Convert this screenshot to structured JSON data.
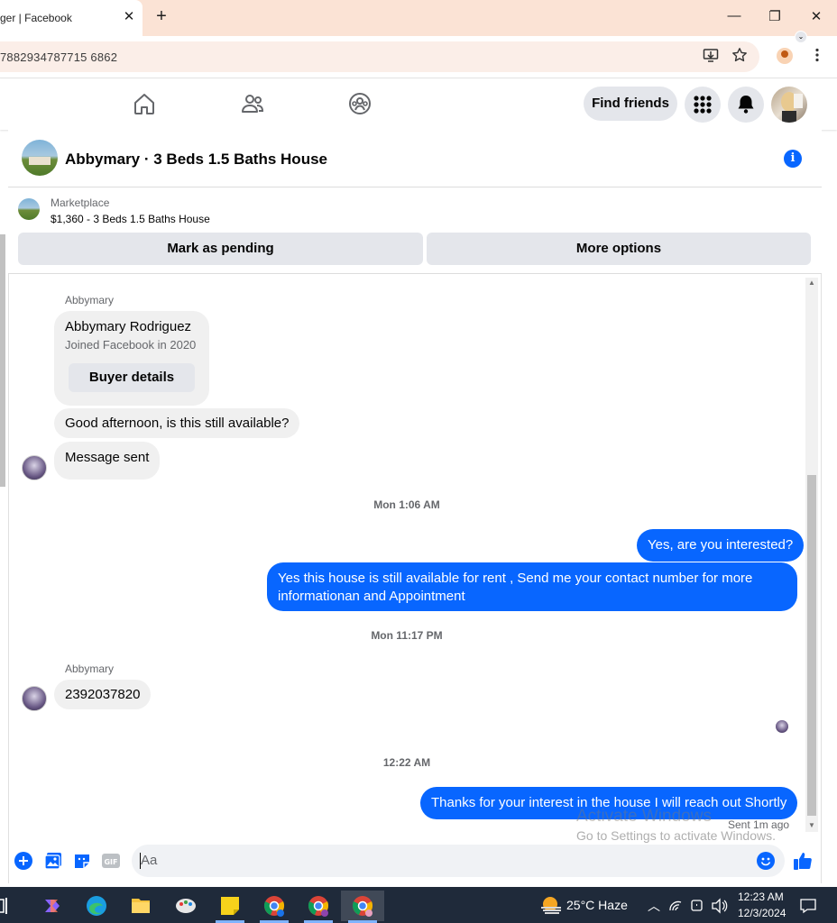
{
  "browser": {
    "tab_title": "ger | Facebook",
    "tab_close": "✕",
    "new_tab": "+",
    "url": "7882934787715 6862",
    "window_controls": [
      "—",
      "❐",
      "✕"
    ]
  },
  "fb_nav": {
    "find_friends": "Find friends"
  },
  "thread": {
    "title": "Abbymary · 3 Beds 1.5 Baths House",
    "info_icon": "i"
  },
  "marketplace": {
    "label": "Marketplace",
    "listing": "$1,360 - 3 Beds 1.5 Baths House",
    "mark_pending": "Mark as pending",
    "more_options": "More options"
  },
  "messages": {
    "sender_1": "Abbymary",
    "card_name": "Abbymary Rodriguez",
    "card_joined": "Joined Facebook in 2020",
    "card_button": "Buyer details",
    "msg_1": "Good afternoon, is this still available?",
    "msg_2": "Message sent",
    "time_1": "Mon 1:06 AM",
    "msg_3": "Yes, are you interested?",
    "msg_4": "Yes this house is still available for rent , Send me your contact number for more informationan and Appointment",
    "time_2": "Mon 11:17 PM",
    "sender_2": "Abbymary",
    "msg_5": "2392037820",
    "time_3": "12:22 AM",
    "msg_6": "Thanks for your interest in the house I will reach out Shortly",
    "sent_status": "Sent 1m ago"
  },
  "watermark": {
    "line1": "Activate Windows",
    "line2": "Go to Settings to activate Windows."
  },
  "composer": {
    "placeholder": "Aa",
    "gif": "GIF"
  },
  "taskbar": {
    "weather": "25°C  Haze",
    "time": "12:23 AM",
    "date": "12/3/2024"
  },
  "colors": {
    "fb_blue": "#0866ff",
    "bubble_gray": "#f0f0f0",
    "tab_strip": "#fbe3d5"
  }
}
